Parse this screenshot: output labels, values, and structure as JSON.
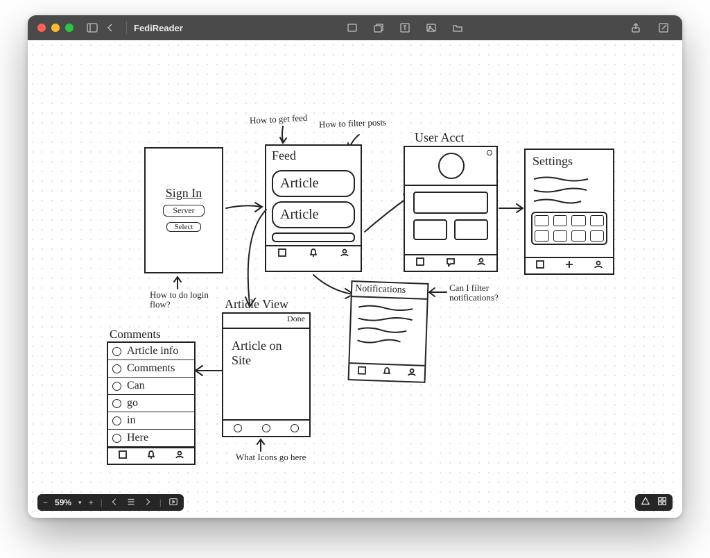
{
  "app_title": "FediReader",
  "zoom_label": "59%",
  "annotations": {
    "how_get_feed": "How to get feed",
    "how_filter_posts": "How to filter posts",
    "user_acct": "User Acct",
    "login_flow": "How to do login flow?",
    "filter_notif": "Can I filter notifications?",
    "what_icons": "What Icons go here"
  },
  "signin": {
    "title": "Sign In",
    "server": "Server",
    "select": "Select"
  },
  "feed": {
    "title": "Feed",
    "card1": "Article",
    "card2": "Article"
  },
  "article_view": {
    "title": "Article View",
    "done": "Done",
    "body": "Article on Site"
  },
  "comments": {
    "title": "Comments",
    "rows": [
      "Article info",
      "Comments",
      "Can",
      "go",
      "in",
      "Here"
    ]
  },
  "notifications": {
    "title": "Notifications"
  },
  "settings": {
    "title": "Settings"
  }
}
